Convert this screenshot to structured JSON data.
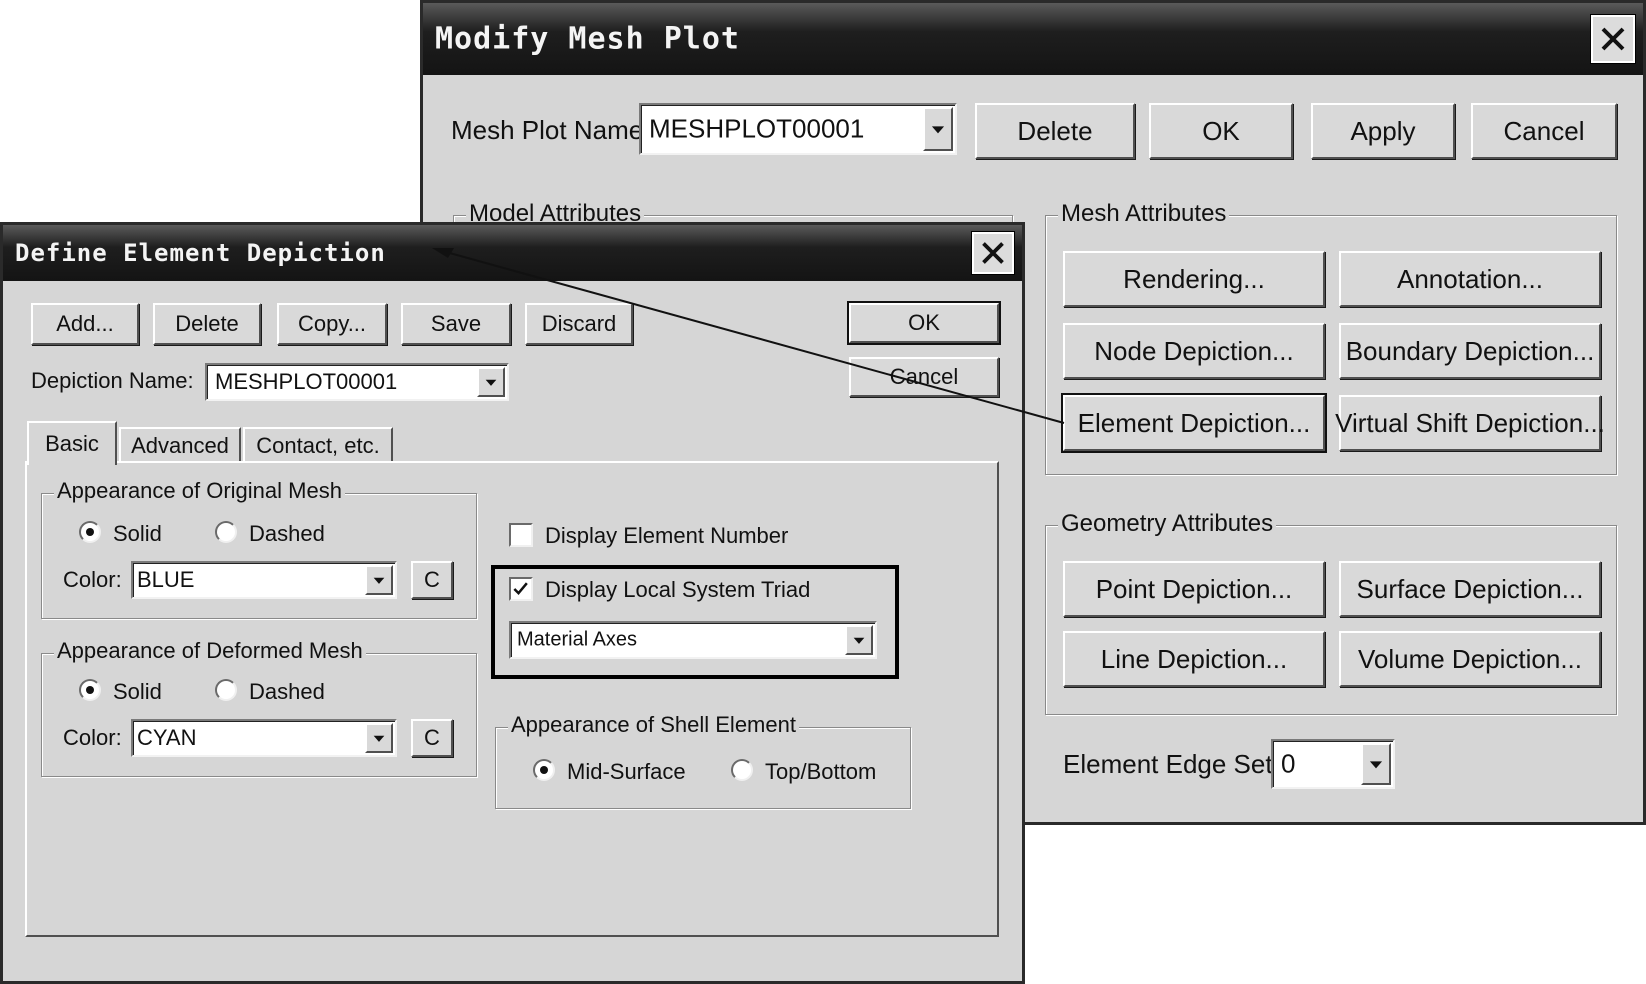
{
  "modify_mesh_plot": {
    "title": "Modify Mesh Plot",
    "mesh_plot_name_label": "Mesh Plot Name:",
    "mesh_plot_name_value": "MESHPLOT00001",
    "buttons": {
      "delete": "Delete",
      "ok": "OK",
      "apply": "Apply",
      "cancel": "Cancel"
    },
    "model_attributes_title": "Model Attributes",
    "mesh_attributes": {
      "title": "Mesh Attributes",
      "rendering": "Rendering...",
      "annotation": "Annotation...",
      "node_depiction": "Node Depiction...",
      "boundary_depiction": "Boundary Depiction...",
      "element_depiction": "Element Depiction...",
      "virtual_shift_depiction": "Virtual Shift Depiction..."
    },
    "geometry_attributes": {
      "title": "Geometry Attributes",
      "point_depiction": "Point Depiction...",
      "surface_depiction": "Surface Depiction...",
      "line_depiction": "Line Depiction...",
      "volume_depiction": "Volume Depiction..."
    },
    "element_edge_set_label": "Element Edge Set:",
    "element_edge_set_value": "0"
  },
  "define_element_depiction": {
    "title": "Define Element Depiction",
    "buttons": {
      "add": "Add...",
      "delete": "Delete",
      "copy": "Copy...",
      "save": "Save",
      "discard": "Discard",
      "ok": "OK",
      "cancel": "Cancel"
    },
    "depiction_name_label": "Depiction Name:",
    "depiction_name_value": "MESHPLOT00001",
    "tabs": [
      "Basic",
      "Advanced",
      "Contact, etc."
    ],
    "active_tab": "Basic",
    "original_mesh": {
      "title": "Appearance of Original Mesh",
      "solid": "Solid",
      "dashed": "Dashed",
      "selected": "Solid",
      "color_label": "Color:",
      "color_value": "BLUE",
      "c_button": "C"
    },
    "deformed_mesh": {
      "title": "Appearance of Deformed Mesh",
      "solid": "Solid",
      "dashed": "Dashed",
      "selected": "Solid",
      "color_label": "Color:",
      "color_value": "CYAN",
      "c_button": "C"
    },
    "display_element_number": {
      "label": "Display Element Number",
      "checked": false
    },
    "display_local_system_triad": {
      "label": "Display Local System Triad",
      "checked": true
    },
    "triad_option_value": "Material Axes",
    "shell_element": {
      "title": "Appearance of Shell Element",
      "mid_surface": "Mid-Surface",
      "top_bottom": "Top/Bottom",
      "selected": "Mid-Surface"
    }
  },
  "colors": {
    "title_bar": "#1e1e1e",
    "dialog_bg": "#d6d6d6",
    "highlight_box": "#000000"
  }
}
